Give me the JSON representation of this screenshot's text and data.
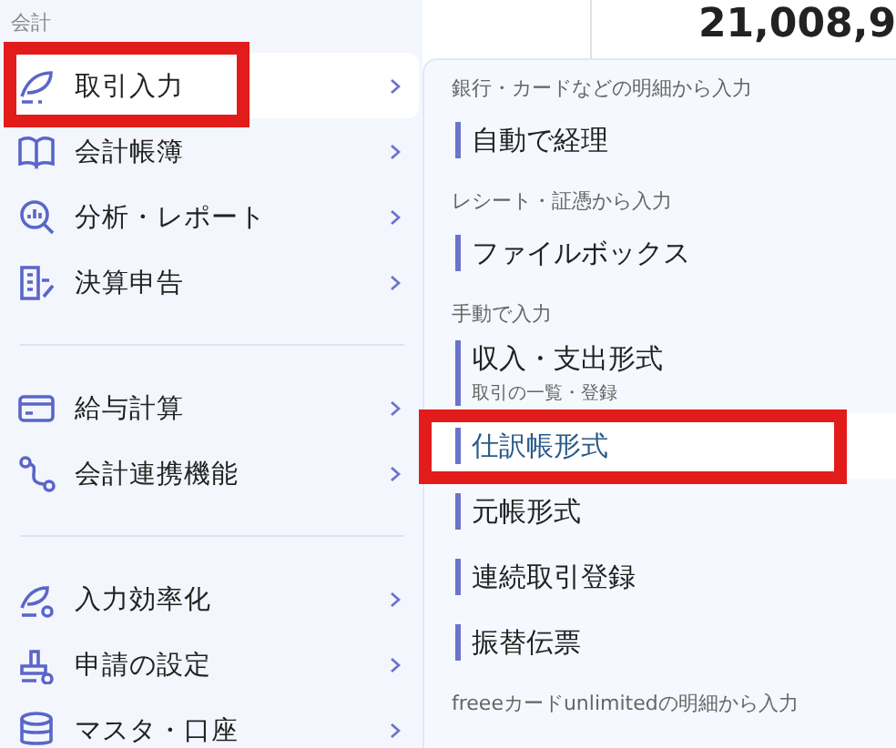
{
  "sidebar": {
    "section_label": "会計",
    "groups": [
      [
        {
          "label": "取引入力",
          "selected": true,
          "highlighted": true
        },
        {
          "label": "会計帳簿",
          "selected": false,
          "highlighted": false
        },
        {
          "label": "分析・レポート",
          "selected": false,
          "highlighted": false
        },
        {
          "label": "決算申告",
          "selected": false,
          "highlighted": false
        }
      ],
      [
        {
          "label": "給与計算",
          "selected": false,
          "highlighted": false
        },
        {
          "label": "会計連携機能",
          "selected": false,
          "highlighted": false
        }
      ],
      [
        {
          "label": "入力効率化",
          "selected": false,
          "highlighted": false
        },
        {
          "label": "申請の設定",
          "selected": false,
          "highlighted": false
        },
        {
          "label": "マスタ・口座",
          "selected": false,
          "highlighted": false
        }
      ]
    ]
  },
  "header": {
    "amount": "21,008,9"
  },
  "submenu": [
    {
      "heading": "銀行・カードなどの明細から入力",
      "items": [
        {
          "label": "自動で経理",
          "selected": false,
          "highlighted": false
        }
      ]
    },
    {
      "heading": "レシート・証憑から入力",
      "items": [
        {
          "label": "ファイルボックス",
          "selected": false,
          "highlighted": false
        }
      ]
    },
    {
      "heading": "手動で入力",
      "items": [
        {
          "label": "収入・支出形式",
          "sublabel": "取引の一覧・登録",
          "selected": false,
          "highlighted": false
        },
        {
          "label": "仕訳帳形式",
          "selected": true,
          "highlighted": true
        },
        {
          "label": "元帳形式",
          "selected": false,
          "highlighted": false
        },
        {
          "label": "連続取引登録",
          "selected": false,
          "highlighted": false
        },
        {
          "label": "振替伝票",
          "selected": false,
          "highlighted": false
        }
      ]
    },
    {
      "heading": "freeeカードunlimitedの明細から入力"
    }
  ]
}
